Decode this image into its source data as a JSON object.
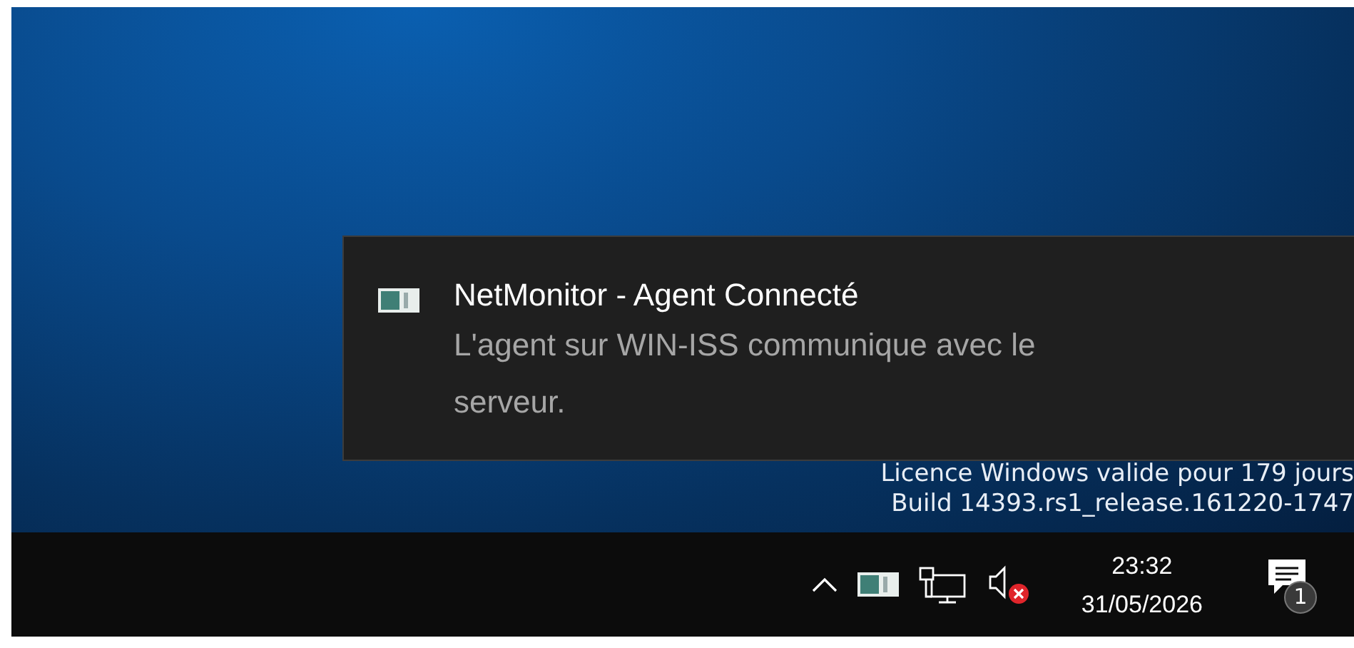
{
  "desktop": {
    "watermark": [
      "Licence Windows valide pour 179 jours",
      "Build 14393.rs1_release.161220-1747"
    ]
  },
  "toast": {
    "title": "NetMonitor - Agent Connecté",
    "body": "L'agent sur WIN-ISS communique avec le serveur."
  },
  "taskbar": {
    "volume": {
      "muted": true
    },
    "clock": {
      "time": "23:32",
      "date": "31/05/2026"
    },
    "notifications": {
      "count": "1"
    }
  }
}
